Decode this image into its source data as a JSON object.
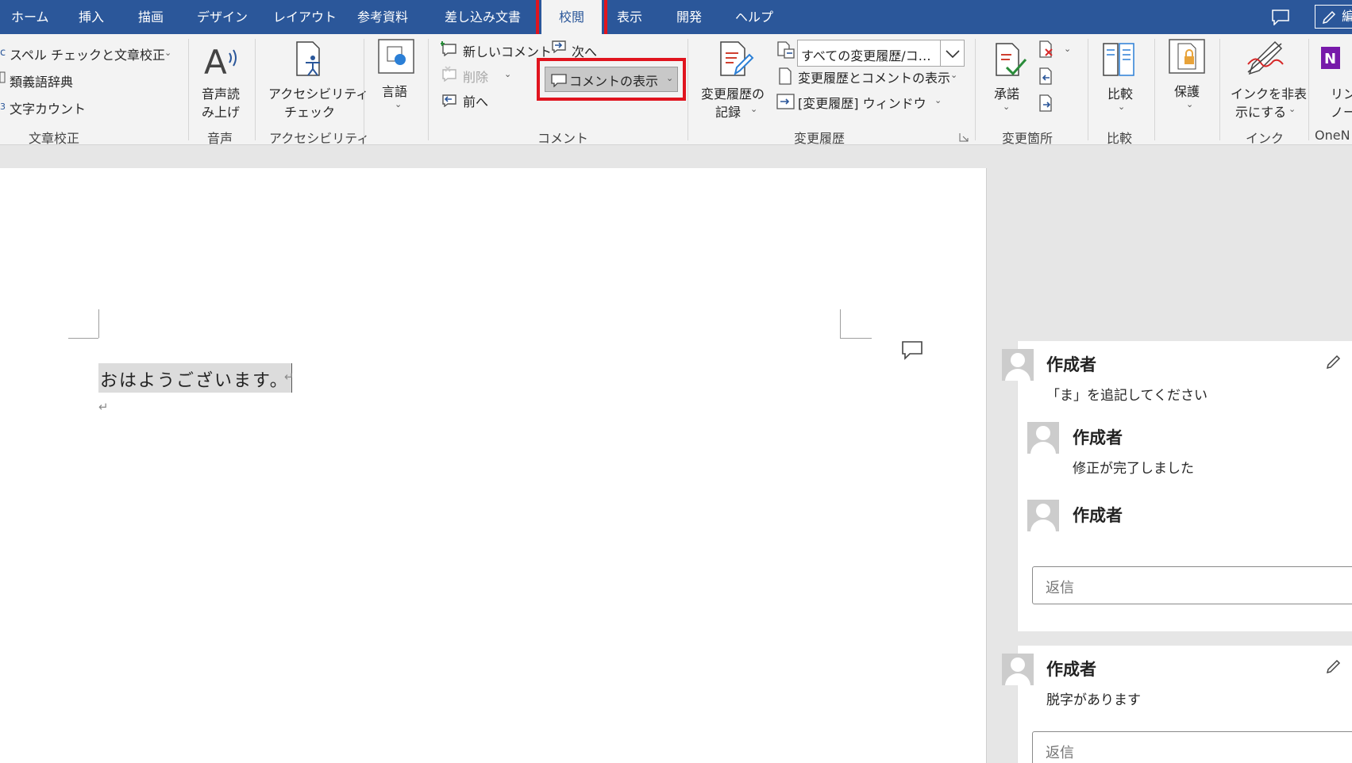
{
  "tabs": [
    "ホーム",
    "挿入",
    "描画",
    "デザイン",
    "レイアウト",
    "参考資料",
    "差し込み文書",
    "校閲",
    "表示",
    "開発",
    "ヘルプ"
  ],
  "active_tab": "校閲",
  "edit_button_label": "編",
  "ribbon": {
    "proofing": {
      "spelling": "スペル チェックと文章校正",
      "thesaurus": "類義語辞典",
      "word_count": "文字カウント",
      "caption": "文章校正"
    },
    "speech": {
      "read_aloud_line1": "音声読",
      "read_aloud_line2": "み上げ",
      "caption": "音声"
    },
    "accessibility": {
      "check_line1": "アクセシビリティ",
      "check_line2": "チェック",
      "caption": "アクセシビリティ"
    },
    "language": {
      "label": "言語"
    },
    "comments": {
      "new_comment": "新しいコメント",
      "delete": "削除",
      "previous": "前へ",
      "next": "次へ",
      "show_comments": "コメントの表示",
      "caption": "コメント"
    },
    "tracking": {
      "track_changes_line1": "変更履歴の",
      "track_changes_line2": "記録",
      "markup_dropdown_value": "すべての変更履歴/コ…",
      "show_markup": "変更履歴とコメントの表示",
      "reviewing_pane": "[変更履歴] ウィンドウ",
      "caption": "変更履歴"
    },
    "changes": {
      "accept": "承諾",
      "caption": "変更箇所"
    },
    "compare": {
      "compare": "比較",
      "caption": "比較"
    },
    "protect": {
      "protect": "保護"
    },
    "ink": {
      "hide_ink_line1": "インクを非表",
      "hide_ink_line2": "示にする",
      "caption": "インク"
    },
    "onenote": {
      "linked_line1": "リン",
      "linked_line2": "ノー",
      "caption": "OneN"
    }
  },
  "document": {
    "text": "おはようございます。",
    "para_mark": "↵"
  },
  "comments": [
    {
      "author": "作成者",
      "text": "「ま」を追記してください",
      "replies": [
        {
          "author": "作成者",
          "text": "修正が完了しました"
        },
        {
          "author": "作成者",
          "text": ""
        }
      ],
      "reply_placeholder": "返信"
    },
    {
      "author": "作成者",
      "text": "脱字があります",
      "replies": [],
      "reply_placeholder": "返信"
    }
  ],
  "colors": {
    "accent": "#2b579a",
    "highlight_red": "#e0141e",
    "ribbon_bg": "#f3f3f3"
  }
}
